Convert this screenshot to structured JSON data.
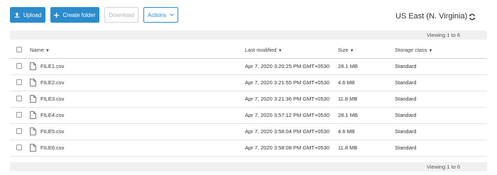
{
  "toolbar": {
    "upload_label": "Upload",
    "create_folder_label": "Create folder",
    "download_label": "Download",
    "actions_label": "Actions"
  },
  "region": "US East (N. Virginia)",
  "viewing_top": "Viewing 1 to 6",
  "viewing_bottom": "Viewing 1 to 6",
  "table": {
    "headers": {
      "name": "Name",
      "last_modified": "Last modified",
      "size": "Size",
      "storage_class": "Storage class"
    },
    "rows": [
      {
        "name": "FILE1.csv",
        "last_modified": "Apr 7, 2020 3:20:25 PM GMT+0530",
        "size": "28.1 MB",
        "storage_class": "Standard"
      },
      {
        "name": "FILE2.csv",
        "last_modified": "Apr 7, 2020 3:21:55 PM GMT+0530",
        "size": "4.6 MB",
        "storage_class": "Standard"
      },
      {
        "name": "FILE3.csv",
        "last_modified": "Apr 7, 2020 3:21:36 PM GMT+0530",
        "size": "11.8 MB",
        "storage_class": "Standard"
      },
      {
        "name": "FILE4.csv",
        "last_modified": "Apr 7, 2020 3:57:12 PM GMT+0530",
        "size": "28.1 MB",
        "storage_class": "Standard"
      },
      {
        "name": "FILE5.csv",
        "last_modified": "Apr 7, 2020 3:58:04 PM GMT+0530",
        "size": "4.6 MB",
        "storage_class": "Standard"
      },
      {
        "name": "FILE6.csv",
        "last_modified": "Apr 7, 2020 3:58:08 PM GMT+0530",
        "size": "11.8 MB",
        "storage_class": "Standard"
      }
    ]
  },
  "icons": {
    "upload": "upload-icon",
    "create_folder": "plus-icon",
    "actions_caret": "chevron-down-icon",
    "refresh": "refresh-icon",
    "file": "file-icon",
    "sort": "caret-down-icon"
  },
  "colors": {
    "primary": "#2b8ccc",
    "bar_background": "#f0f0f0"
  }
}
